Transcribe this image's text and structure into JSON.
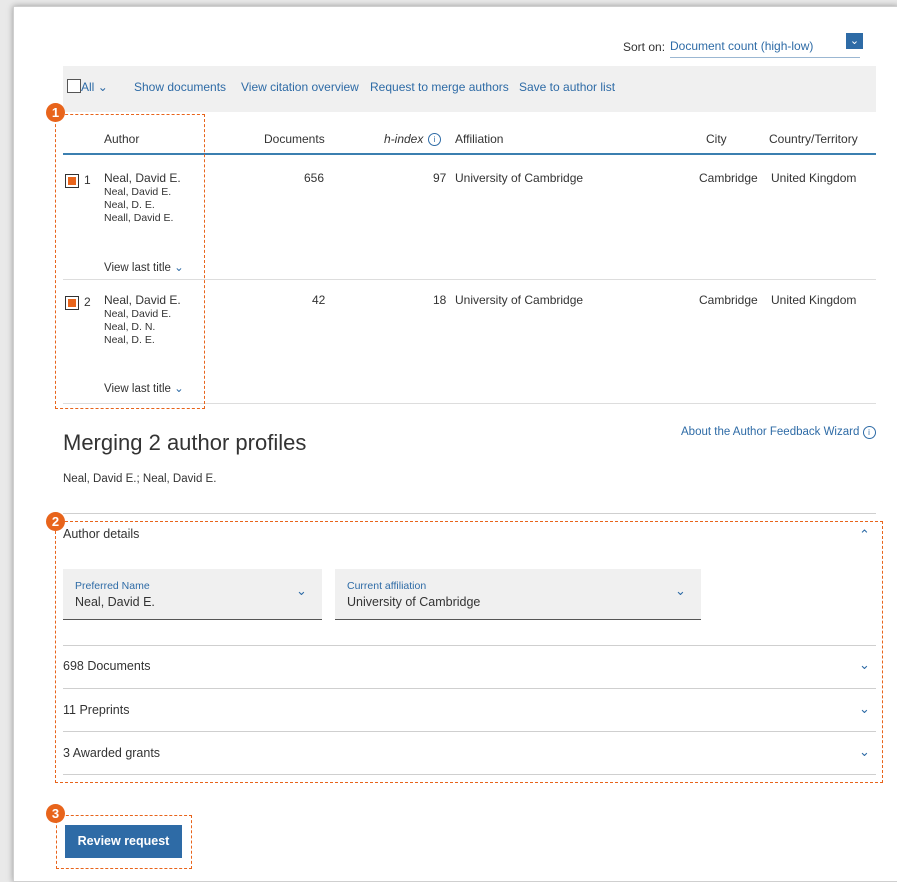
{
  "sort": {
    "label": "Sort on:",
    "value": "Document count (high-low)"
  },
  "toolbar": {
    "all_label": "All",
    "show_documents": "Show documents",
    "view_citation_overview": "View citation overview",
    "request_merge": "Request to merge authors",
    "save_author_list": "Save to author list"
  },
  "table": {
    "headers": {
      "author": "Author",
      "documents": "Documents",
      "hindex": "h-index",
      "affiliation": "Affiliation",
      "city": "City",
      "country": "Country/Territory"
    },
    "rows": [
      {
        "num": "1",
        "name": "Neal, David E.",
        "aliases": [
          "Neal, David E.",
          "Neal, D. E.",
          "Neall, David E."
        ],
        "documents": "656",
        "hindex": "97",
        "affiliation": "University of Cambridge",
        "city": "Cambridge",
        "country": "United Kingdom",
        "view_last": "View last title"
      },
      {
        "num": "2",
        "name": "Neal, David E.",
        "aliases": [
          "Neal, David E.",
          "Neal, D. N.",
          "Neal, D. E."
        ],
        "documents": "42",
        "hindex": "18",
        "affiliation": "University of Cambridge",
        "city": "Cambridge",
        "country": "United Kingdom",
        "view_last": "View last title"
      }
    ]
  },
  "merge": {
    "title": "Merging 2 author profiles",
    "names": "Neal, David E.; Neal, David E.",
    "feedback_link": "About the Author Feedback Wizard"
  },
  "sections": {
    "author_details": "Author details",
    "preferred_name_label": "Preferred Name",
    "preferred_name_value": "Neal, David E.",
    "current_affiliation_label": "Current affiliation",
    "current_affiliation_value": "University of Cambridge",
    "documents": "698 Documents",
    "preprints": "11 Preprints",
    "grants": "3 Awarded grants"
  },
  "review_button": "Review request",
  "badges": [
    "1",
    "2",
    "3"
  ],
  "colors": {
    "accent": "#2e6ba6",
    "highlight": "#e8641b"
  }
}
